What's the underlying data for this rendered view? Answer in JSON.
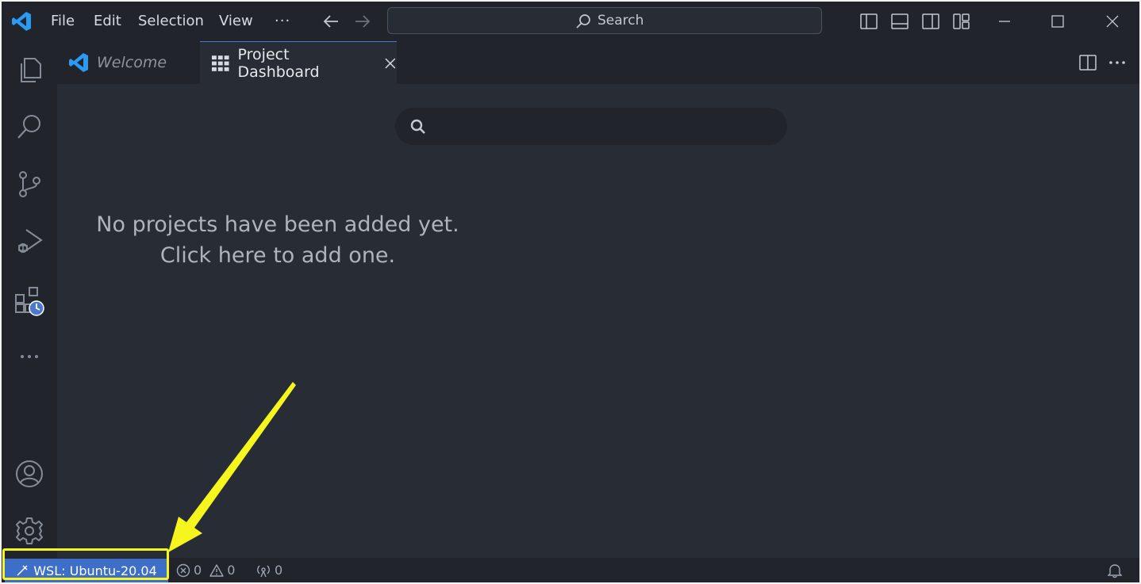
{
  "menu": {
    "file": "File",
    "edit": "Edit",
    "selection": "Selection",
    "view": "View",
    "more": "···"
  },
  "titlebar": {
    "search_label": "Search"
  },
  "tabs": [
    {
      "label": "Welcome"
    },
    {
      "label": "Project Dashboard"
    }
  ],
  "dashboard": {
    "search_placeholder": "",
    "empty_line1": "No projects have been added yet.",
    "empty_line2": "Click here to add one."
  },
  "statusbar": {
    "remote_label": "WSL: Ubuntu-20.04",
    "errors": "0",
    "warnings": "0",
    "ports": "0"
  },
  "colors": {
    "accent": "#3e6fc8",
    "highlight": "#f6f51d",
    "vscode_blue": "#2b9af3"
  }
}
